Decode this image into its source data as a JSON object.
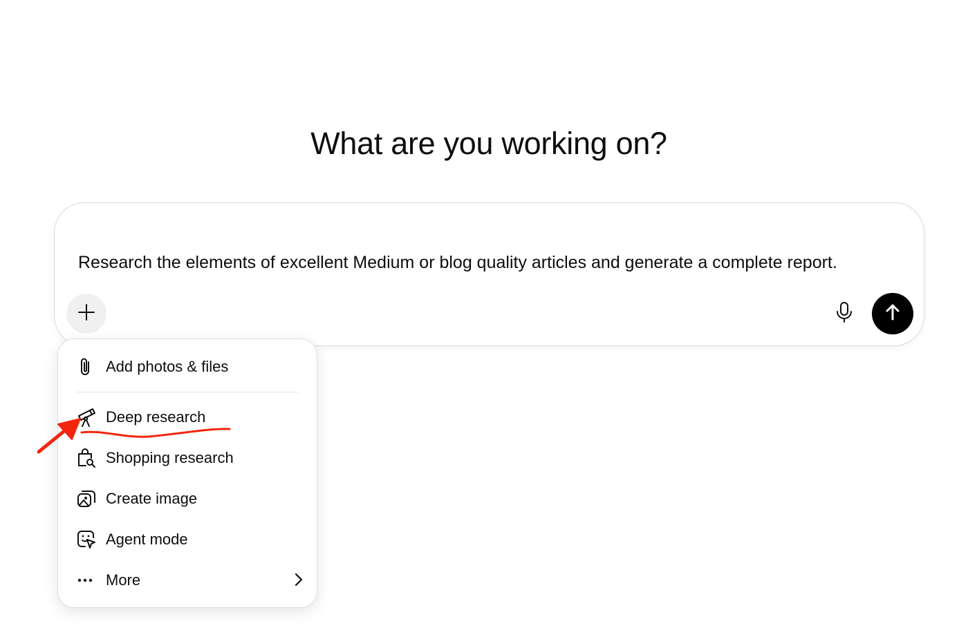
{
  "heading": "What are you working on?",
  "composer": {
    "prompt": "Research the elements of excellent Medium or blog quality articles and generate a complete report.",
    "plus_icon": "plus-icon",
    "mic_icon": "microphone-icon",
    "send_icon": "arrow-up-icon"
  },
  "menu": {
    "items": [
      {
        "label": "Add photos & files",
        "icon": "paperclip-icon"
      },
      {
        "label": "Deep research",
        "icon": "telescope-icon"
      },
      {
        "label": "Shopping research",
        "icon": "shopping-bag-search-icon"
      },
      {
        "label": "Create image",
        "icon": "image-icon"
      },
      {
        "label": "Agent mode",
        "icon": "agent-cursor-icon"
      },
      {
        "label": "More",
        "icon": "ellipsis-icon",
        "submenu": "chevron-right-icon"
      }
    ]
  },
  "annotation": {
    "color": "#f2260f"
  },
  "colors": {
    "send_button": "#000000",
    "plus_button_bg": "#f0f0f0",
    "text": "#0d0d0d"
  }
}
